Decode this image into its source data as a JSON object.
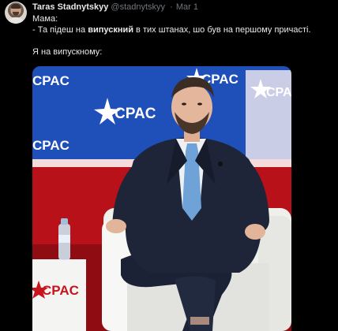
{
  "tweet": {
    "author_name": "Taras Stadnytskyy",
    "handle": "@stadnytskyy",
    "separator": "·",
    "date": "Mar 1",
    "line1": "Мама:",
    "line2_prefix": "- Та підеш на ",
    "line2_bold": "випускний",
    "line2_suffix": " в тих штанах, шо був на першому причасті.",
    "line3": "Я на випускному:"
  },
  "media": {
    "description_icon": "photo",
    "logo_text": "CPAC",
    "colors": {
      "backdrop_blue": "#1f4fb8",
      "stage_red": "#c8141c",
      "chair_white": "#f2f2f0",
      "suit_navy": "#1e2538",
      "tie_blue": "#6fa3d8"
    }
  }
}
